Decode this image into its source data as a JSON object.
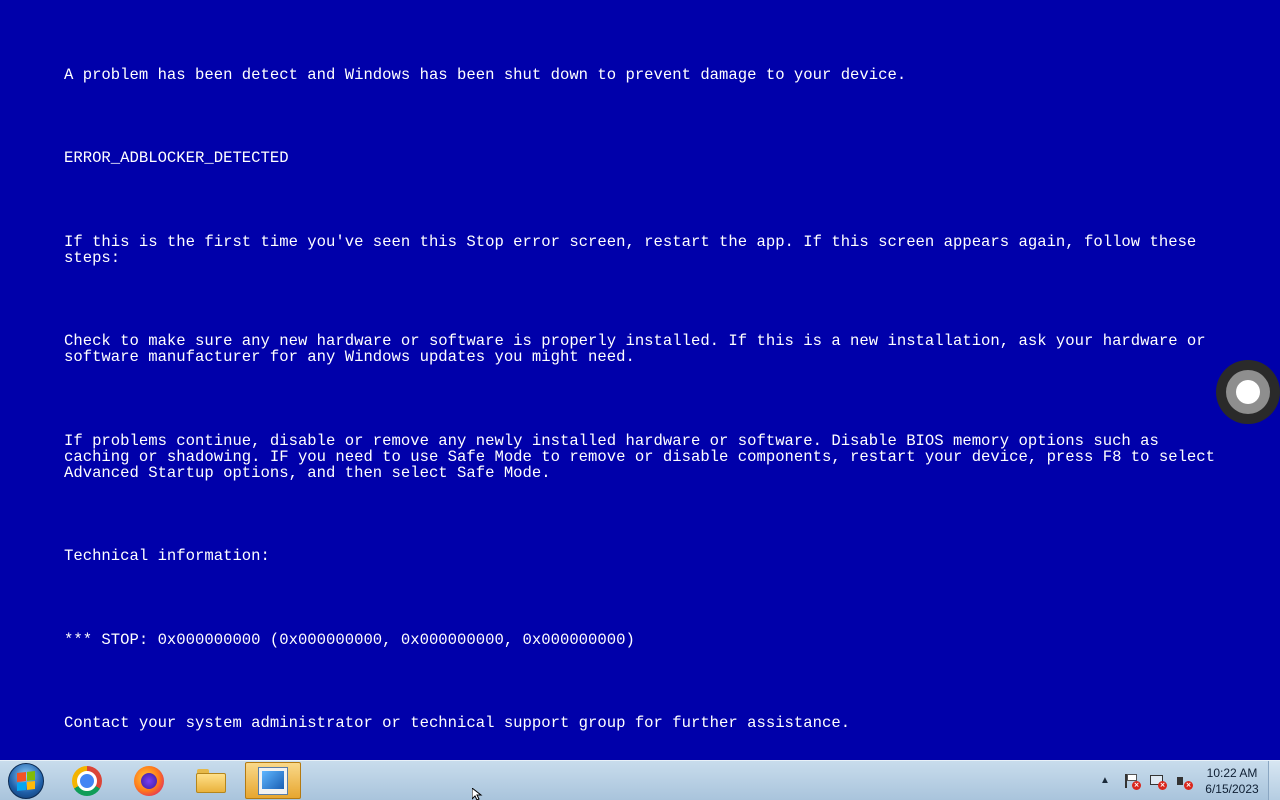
{
  "bsod": {
    "line1": "A problem has been detect and Windows has been shut down to prevent damage to your device.",
    "error_code": "ERROR_ADBLOCKER_DETECTED",
    "first_time": "If this is the first time you've seen this Stop error screen, restart the app. If this screen appears again, follow these steps:",
    "check_hardware": "Check to make sure any new hardware or software is properly installed. If this is a new installation, ask your hardware or software manufacturer for any Windows updates you might need.",
    "problems_continue": "If problems continue, disable or remove any newly installed hardware or software. Disable BIOS memory options such as caching or shadowing. IF you need to use Safe Mode to remove or disable components, restart your device, press F8 to select Advanced Startup options, and then select Safe Mode.",
    "technical_info": "Technical information:",
    "stop_line": "*** STOP: 0x000000000 (0x000000000, 0x000000000, 0x000000000)",
    "contact": "Contact your system administrator or technical support group for further assistance."
  },
  "colors": {
    "background": "#0000aa",
    "text": "#ffffff"
  },
  "taskbar": {
    "items": [
      {
        "icon": "windows-start-icon"
      },
      {
        "icon": "chrome-icon"
      },
      {
        "icon": "firefox-icon"
      },
      {
        "icon": "file-explorer-icon"
      },
      {
        "icon": "app-window-icon",
        "active": true
      }
    ],
    "tray": {
      "show_hidden_icon": "▲",
      "icons": [
        "action-center-flag-icon",
        "network-icon",
        "volume-muted-icon"
      ],
      "time": "10:22 AM",
      "date": "6/15/2023"
    }
  }
}
